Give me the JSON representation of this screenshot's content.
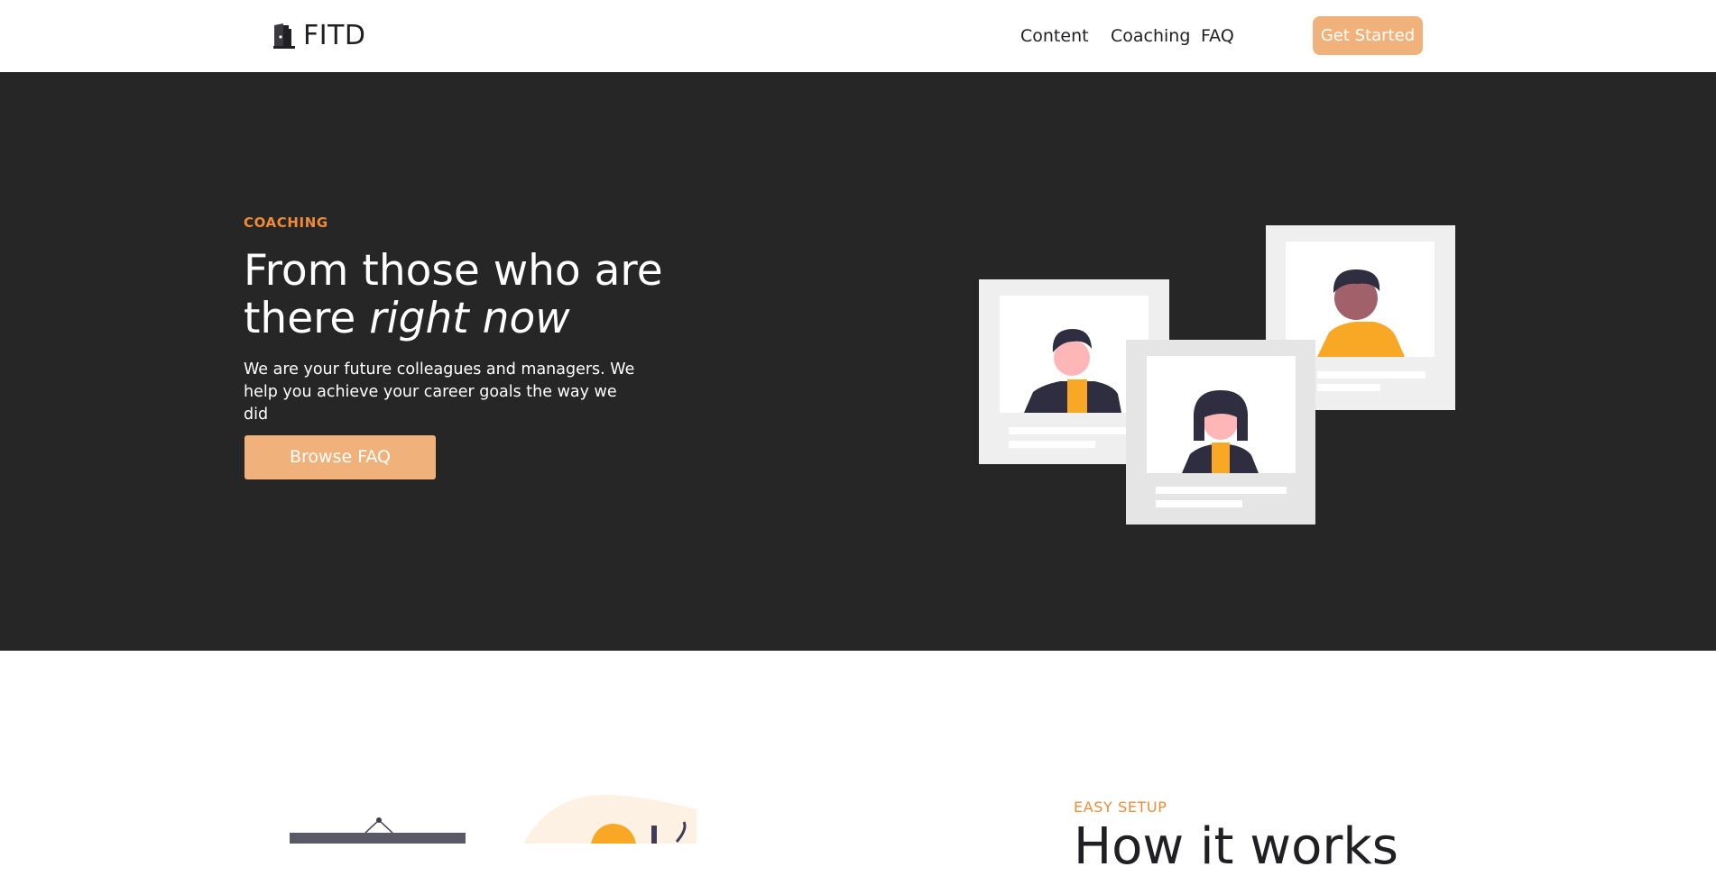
{
  "nav": {
    "logo_text": "FITD",
    "links": [
      {
        "label": "Content"
      },
      {
        "label": "Coaching"
      },
      {
        "label": "FAQ"
      }
    ],
    "cta_label": "Get Started"
  },
  "hero": {
    "eyebrow": "COACHING",
    "title_plain": "From those who are there ",
    "title_emphasis": "right now",
    "description": "We are your future colleagues and managers. We help you achieve your career goals the way we did",
    "button_label": "Browse FAQ"
  },
  "section2": {
    "eyebrow": "EASY SETUP",
    "title_partial": "How it works"
  },
  "colors": {
    "accent": "#f0b27a",
    "eyebrow": "#f08a37",
    "hero_bg": "#262626",
    "nav_bg": "#ffffff"
  },
  "icons": {
    "logo": "door-icon"
  }
}
